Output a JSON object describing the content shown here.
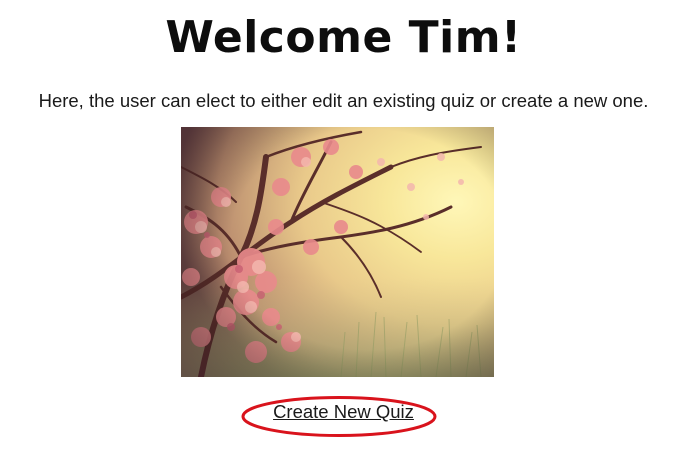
{
  "header": {
    "title": "Welcome Tim!"
  },
  "main": {
    "description": "Here, the user can elect to either edit an existing quiz or create a new one.",
    "image": {
      "subject": "pink blossom tree in hazy sunlight"
    },
    "create_link_label": "Create New Quiz"
  },
  "colors": {
    "text": "#1a1a1a",
    "highlight_ring": "#d9131c",
    "background": "#ffffff"
  }
}
